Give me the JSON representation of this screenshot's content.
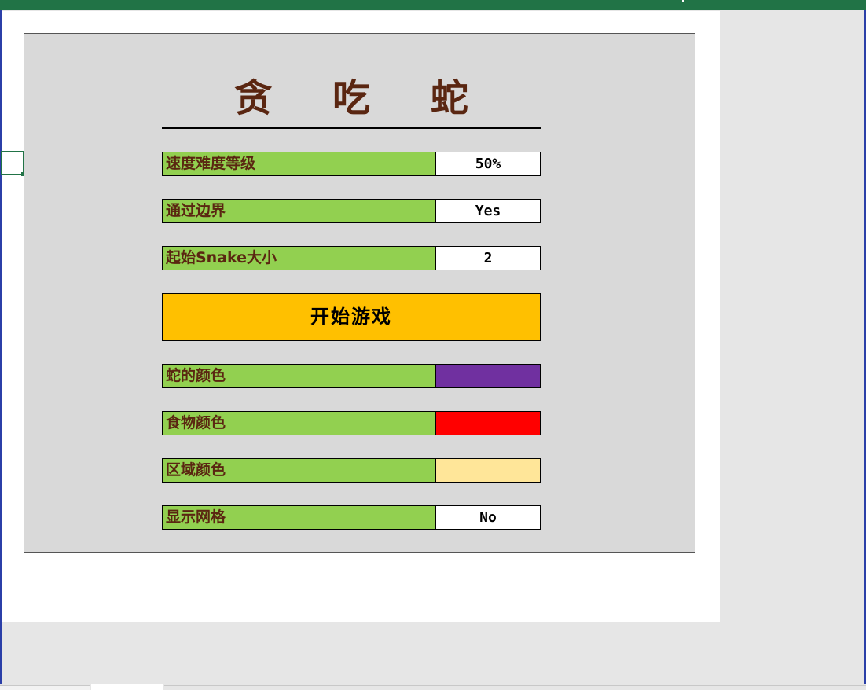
{
  "game": {
    "title": "贪 吃 蛇",
    "start_button": "开始游戏"
  },
  "settings": [
    {
      "label": "速度难度等级",
      "value": "50%"
    },
    {
      "label": "通过边界",
      "value": "Yes"
    },
    {
      "label": "起始Snake大小",
      "value": "2"
    }
  ],
  "colors": [
    {
      "label": "蛇的颜色",
      "swatch": "#7030a0"
    },
    {
      "label": "食物颜色",
      "swatch": "#ff0000"
    },
    {
      "label": "区域颜色",
      "swatch": "#ffe699"
    }
  ],
  "grid_setting": {
    "label": "显示网格",
    "value": "No"
  },
  "theme": {
    "panel_bg": "#d9d9d9",
    "label_bg": "#92d050",
    "label_text": "#5a2611",
    "button_bg": "#ffc000",
    "ribbon": "#217346"
  }
}
